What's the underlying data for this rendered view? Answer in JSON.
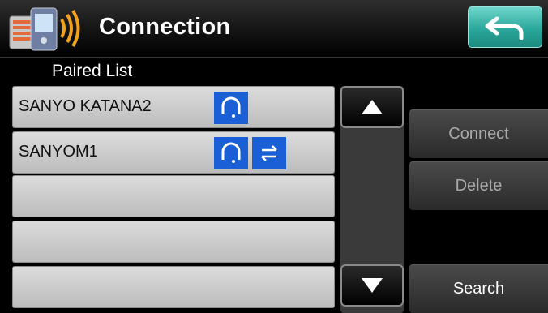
{
  "header": {
    "title": "Connection",
    "icon": "phone-bluetooth-icon",
    "back_icon": "back-arrow-icon",
    "back_color": "#2aa79b"
  },
  "paired_list": {
    "label": "Paired List",
    "rows": [
      {
        "name": "SANYO KATANA2",
        "badges": [
          "headset-icon"
        ]
      },
      {
        "name": "SANYOM1",
        "badges": [
          "headset-icon",
          "transfer-arrows-icon"
        ]
      },
      {
        "name": "",
        "badges": []
      },
      {
        "name": "",
        "badges": []
      },
      {
        "name": "",
        "badges": []
      }
    ],
    "badge_color": "#1b5fd6"
  },
  "scroll": {
    "up_icon": "triangle-up-icon",
    "down_icon": "triangle-down-icon"
  },
  "actions": {
    "connect_label": "Connect",
    "delete_label": "Delete",
    "search_label": "Search"
  }
}
